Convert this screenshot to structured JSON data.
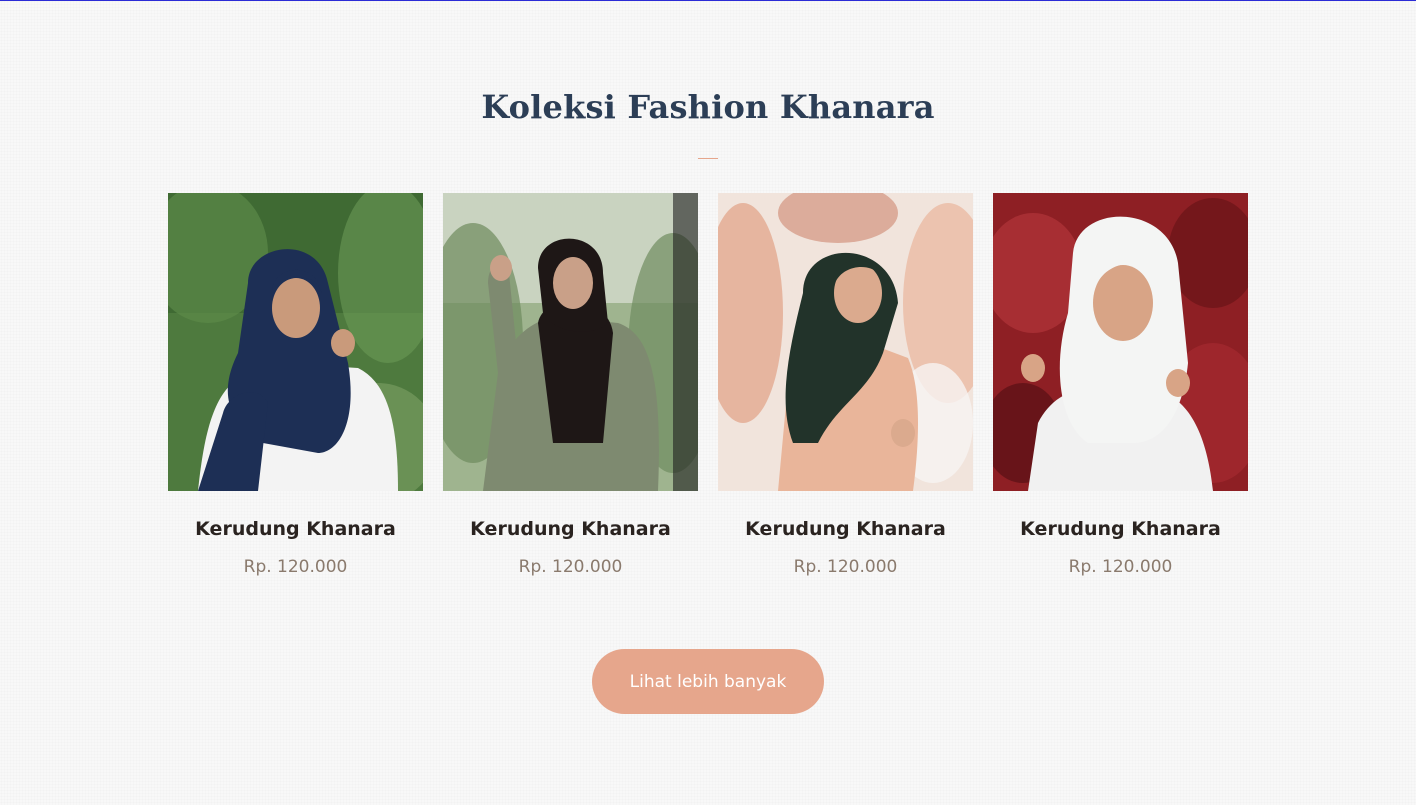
{
  "section": {
    "title": "Koleksi Fashion Khanara"
  },
  "products": [
    {
      "name": "Kerudung Khanara",
      "price": "Rp. 120.000"
    },
    {
      "name": "Kerudung Khanara",
      "price": "Rp. 120.000"
    },
    {
      "name": "Kerudung Khanara",
      "price": "Rp. 120.000"
    },
    {
      "name": "Kerudung Khanara",
      "price": "Rp. 120.000"
    }
  ],
  "cta": {
    "label": "Lihat lebih banyak"
  },
  "colors": {
    "title": "#2c3e56",
    "accent": "#e6a68c",
    "price": "#8a7a6d"
  }
}
